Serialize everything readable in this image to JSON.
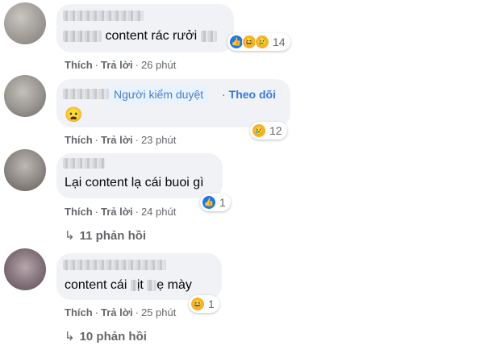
{
  "comments": [
    {
      "text_before": "",
      "text_main": "content rác rưởi",
      "reactions": [
        "like-icon",
        "haha-icon",
        "sad-icon"
      ],
      "reaction_count": "14",
      "actions": {
        "like": "Thích",
        "reply": "Trả lời",
        "time": "26 phút"
      }
    },
    {
      "badge": "Người kiểm duyệt",
      "follow": "Theo dõi",
      "emoji": "😦",
      "reactions": [
        "sad-icon"
      ],
      "reaction_count": "12",
      "actions": {
        "like": "Thích",
        "reply": "Trả lời",
        "time": "23 phút"
      }
    },
    {
      "text_main": "Lại content lạ cái buoi gì",
      "reactions": [
        "like-icon"
      ],
      "reaction_count": "1",
      "actions": {
        "like": "Thích",
        "reply": "Trả lời",
        "time": "24 phút"
      },
      "replies": "11 phản hồi"
    },
    {
      "text_a": "content cái",
      "text_b": "ịt",
      "text_c": "ẹ mày",
      "reactions": [
        "haha-icon"
      ],
      "reaction_count": "1",
      "actions": {
        "like": "Thích",
        "reply": "Trả lời",
        "time": "25 phút"
      },
      "replies": "10 phản hồi"
    }
  ],
  "icons": {
    "reply_arrow": "↳",
    "dot": "·",
    "like": "👍",
    "haha": "😆",
    "sad": "😢"
  },
  "colors": {
    "bubble": "#f0f2f5",
    "like_blue": "#1877f2",
    "follow_blue": "#3578e5",
    "meta_gray": "#65676b"
  }
}
